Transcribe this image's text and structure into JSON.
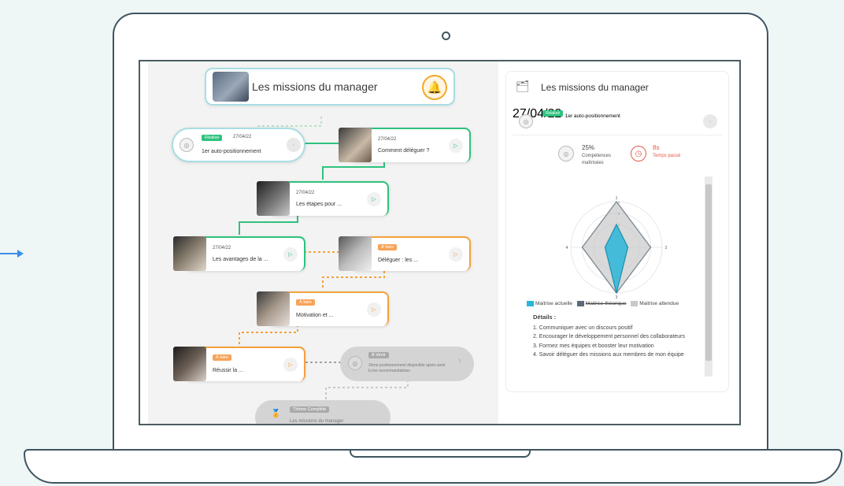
{
  "laptop": {
    "frame_color": "#3f5560",
    "accent_arrow_color": "#3a8ee6"
  },
  "left_panel": {
    "title": "Les missions du manager",
    "cards": [
      {
        "id": "c1",
        "badge": "Réalisé",
        "date": "27/04/22",
        "title": "1er auto-positionnement",
        "style": "blue"
      },
      {
        "id": "c2",
        "badge": "",
        "date": "27/04/22",
        "title": "Comment déléguer ?",
        "style": "green"
      },
      {
        "id": "c3",
        "badge": "",
        "date": "27/04/22",
        "title": "Les étapes pour ...",
        "style": "green"
      },
      {
        "id": "c4",
        "badge": "",
        "date": "27/04/22",
        "title": "Les avantages de la ...",
        "style": "green"
      },
      {
        "id": "c5",
        "badge": "À faire",
        "date": "",
        "title": "Déléguer : les ...",
        "style": "orange"
      },
      {
        "id": "c6",
        "badge": "À faire",
        "date": "",
        "title": "Motivation et ...",
        "style": "orange"
      },
      {
        "id": "c7",
        "badge": "À faire",
        "date": "",
        "title": "Réussir la ...",
        "style": "orange"
      },
      {
        "id": "c8",
        "badge": "À Venir",
        "date": "",
        "title": "2ème positionnement disponible après avoir lu les recommandations",
        "style": "grey"
      },
      {
        "id": "c9",
        "badge": "Thème Complété",
        "date": "",
        "title": "Les missions du manager",
        "style": "grey"
      }
    ]
  },
  "right_panel": {
    "title": "Les missions du manager",
    "card": {
      "badge": "Réalisé",
      "date": "27/04/22",
      "title": "1er auto-positionnement"
    },
    "stats": {
      "competences_value": "25%",
      "competences_label_1": "Compétences",
      "competences_label_2": "maîtrisées",
      "time_value": "8s",
      "time_label": "Temps passé"
    },
    "legend": {
      "current": "Maitrise actuelle",
      "theoretical": "Maitrise théorique",
      "expected": "Maitrise attendue"
    },
    "details_title": "Détails :",
    "details": [
      "1. Communiquer avec un discours positif",
      "2. Encourager le développement personnel des collaborateurs",
      "3. Formez mes équipes et booster leur motivation",
      "4. Savoir déléguer des missions aux membres de mon équipe"
    ]
  },
  "chart_data": {
    "type": "radar",
    "axes": [
      "1",
      "2",
      "3",
      "4"
    ],
    "scale_ticks": [
      "1",
      "2",
      "3",
      "4"
    ],
    "series": [
      {
        "name": "Maitrise actuelle",
        "values": [
          2,
          1,
          4,
          1
        ],
        "color": "#29b6d8"
      },
      {
        "name": "Maitrise théorique",
        "values": [
          4,
          3,
          4,
          3
        ],
        "color": "#9e9e9e"
      },
      {
        "name": "Maitrise attendue",
        "values": [
          4,
          3,
          4,
          3
        ],
        "color": "#c9c9c9"
      }
    ],
    "max": 4
  },
  "colors": {
    "done_green": "#2ec27e",
    "todo_orange": "#f2a23a",
    "light_blue": "#a9dde3",
    "time_red": "#e25a4a"
  }
}
